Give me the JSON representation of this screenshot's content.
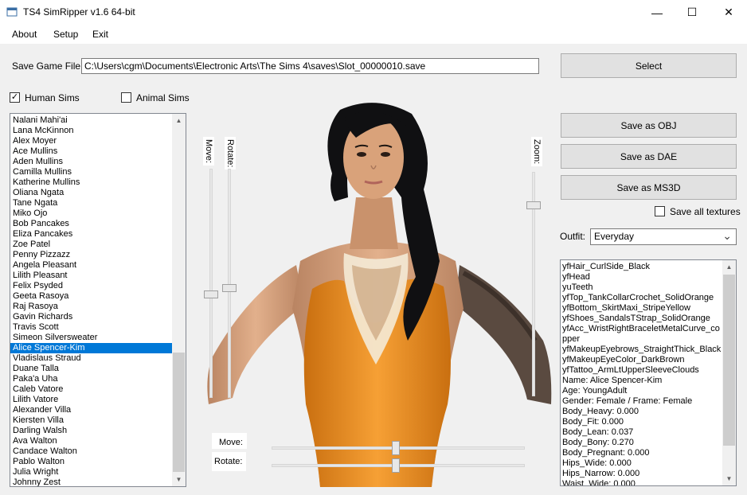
{
  "window": {
    "title": "TS4 SimRipper v1.6 64-bit",
    "minimize_glyph": "—",
    "maximize_glyph": "☐",
    "close_glyph": "✕"
  },
  "menu": [
    "About",
    "Setup",
    "Exit"
  ],
  "save_game": {
    "label": "Save Game File:",
    "path": "C:\\Users\\cgm\\Documents\\Electronic Arts\\The Sims 4\\saves\\Slot_00000010.save",
    "select_label": "Select"
  },
  "filters": {
    "human_label": "Human Sims",
    "human_checked": true,
    "animal_label": "Animal Sims",
    "animal_checked": false
  },
  "sims": [
    "Nalani Mahi'ai",
    "Lana McKinnon",
    "Alex Moyer",
    "Ace Mullins",
    "Aden Mullins",
    "Camilla Mullins",
    "Katherine Mullins",
    "Oliana Ngata",
    "Tane Ngata",
    "Miko Ojo",
    "Bob Pancakes",
    "Eliza Pancakes",
    "Zoe Patel",
    "Penny Pizzazz",
    "Angela Pleasant",
    "Lilith Pleasant",
    "Felix Psyded",
    "Geeta Rasoya",
    "Raj Rasoya",
    "Gavin Richards",
    "Travis Scott",
    "Simeon Silversweater",
    "Alice Spencer-Kim",
    "Vladislaus Straud",
    "Duane Talla",
    "Paka'a Uha",
    "Caleb Vatore",
    "Lilith Vatore",
    "Alexander Villa",
    "Kiersten Villa",
    "Darling Walsh",
    "Ava Walton",
    "Candace Walton",
    "Pablo Walton",
    "Julia Wright",
    "Johnny Zest"
  ],
  "selected_sim_index": 22,
  "viewport": {
    "move_label": "Move:",
    "rotate_label": "Rotate:",
    "zoom_label": "Zoom:",
    "h_move_label": "Move:",
    "h_rotate_label": "Rotate:"
  },
  "sliders": {
    "v_move": 0.55,
    "v_rotate": 0.52,
    "zoom": 0.15,
    "h_move": 0.49,
    "h_rotate": 0.49
  },
  "actions": {
    "save_obj": "Save as OBJ",
    "save_dae": "Save as DAE",
    "save_ms3d": "Save as MS3D",
    "save_textures_label": "Save all textures",
    "save_textures_checked": false
  },
  "outfit": {
    "label": "Outfit:",
    "value": "Everyday"
  },
  "info": [
    "yfHair_CurlSide_Black",
    "yfHead",
    "yuTeeth",
    "yfTop_TankCollarCrochet_SolidOrange",
    "yfBottom_SkirtMaxi_StripeYellow",
    "yfShoes_SandalsTStrap_SolidOrange",
    "yfAcc_WristRightBraceletMetalCurve_copper",
    "yfMakeupEyebrows_StraightThick_Black",
    "yfMakeupEyeColor_DarkBrown",
    "yfTattoo_ArmLtUpperSleeveClouds",
    "Name: Alice Spencer-Kim",
    "Age: YoungAdult",
    "Gender: Female / Frame: Female",
    "Body_Heavy: 0.000",
    "Body_Fit: 0.000",
    "Body_Lean: 0.037",
    "Body_Bony: 0.270",
    "Body_Pregnant: 0.000",
    "Hips_Wide: 0.000",
    "Hips_Narrow: 0.000",
    "Waist_Wide: 0.000"
  ],
  "colors": {
    "selection": "#0078d7",
    "dress": "#f0961e",
    "skin": "#d9a27a",
    "hair": "#101012"
  },
  "icons": {
    "app": "app-icon",
    "checkmark": "✓",
    "scroll_up": "▲",
    "scroll_down": "▼",
    "dropdown": "⌄"
  }
}
